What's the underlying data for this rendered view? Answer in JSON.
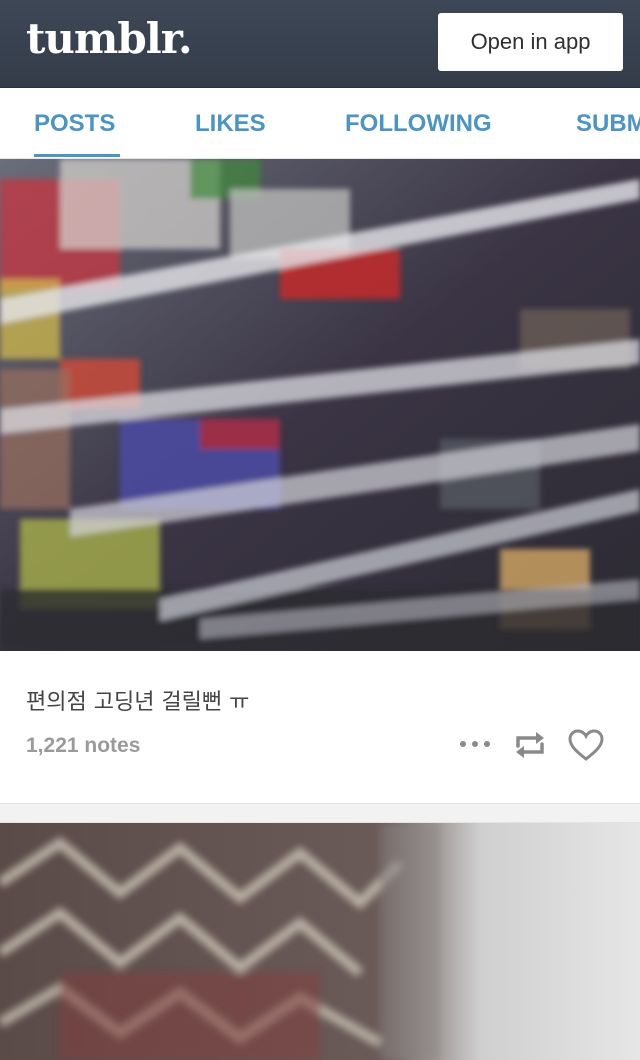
{
  "header": {
    "logo": "tumblr.",
    "open_in_app": "Open in app"
  },
  "tabs": [
    {
      "label": "POSTS",
      "active": true
    },
    {
      "label": "LIKES",
      "active": false
    },
    {
      "label": "FOLLOWING",
      "active": false
    },
    {
      "label": "SUBMIT",
      "active": false
    }
  ],
  "post": {
    "caption": "편의점 고딩년 걸릴뻔 ㅠ",
    "notes": "1,221 notes",
    "actions": [
      "more-icon",
      "reblog-icon",
      "heart-icon"
    ]
  },
  "colors": {
    "header_bg": "#343c49",
    "tab_accent": "#4a94c6",
    "notes_gray": "#9a9a9a"
  }
}
